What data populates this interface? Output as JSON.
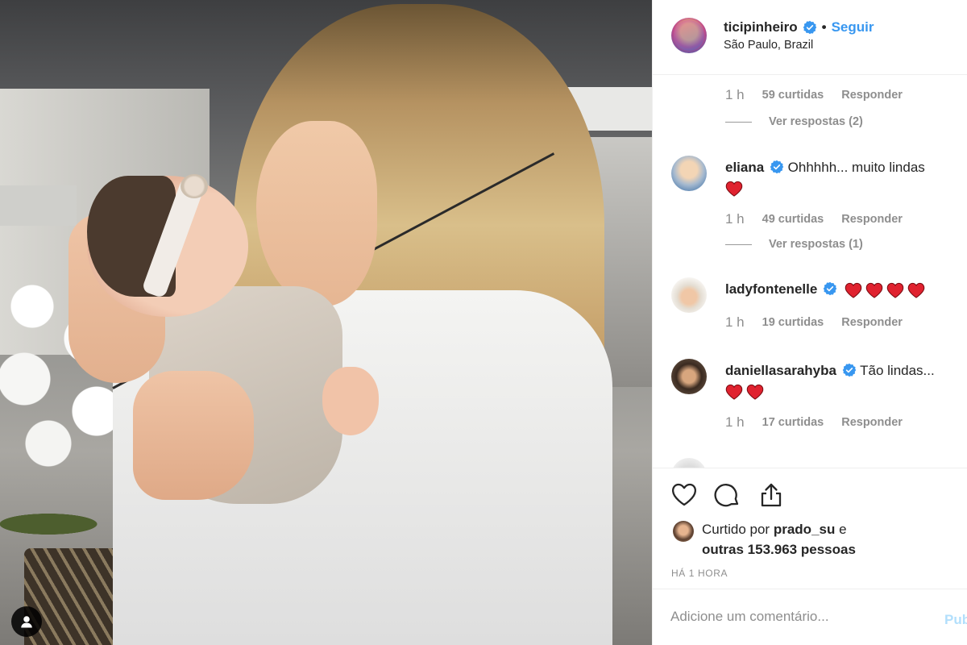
{
  "post": {
    "username": "ticipinheiro",
    "follow_label": "Seguir",
    "separator": "•",
    "location": "São Paulo, Brazil"
  },
  "comments": [
    {
      "time": "1 h",
      "likes": "59 curtidas",
      "reply": "Responder",
      "view_replies": "Ver respostas (2)"
    },
    {
      "username": "eliana",
      "text": "Ohhhhh... muito lindas",
      "hearts": 1,
      "time": "1 h",
      "likes": "49 curtidas",
      "reply": "Responder",
      "view_replies": "Ver respostas (1)"
    },
    {
      "username": "ladyfontenelle",
      "text": "",
      "hearts": 4,
      "time": "1 h",
      "likes": "19 curtidas",
      "reply": "Responder"
    },
    {
      "username": "daniellasarahyba",
      "text": "Tão lindas...",
      "hearts": 2,
      "time": "1 h",
      "likes": "17 curtidas",
      "reply": "Responder"
    }
  ],
  "likes": {
    "prefix": "Curtido por",
    "user": "prado_su",
    "conjunction": "e",
    "others": "outras 153.963 pessoas"
  },
  "time_ago": "HÁ 1 HORA",
  "add_comment": {
    "placeholder": "Adicione um comentário...",
    "publish_label": "Pub"
  },
  "icons": {
    "verified": "verified-badge-icon",
    "heart": "heart-emoji-icon",
    "like": "heart-outline-icon",
    "comment": "comment-bubble-icon",
    "share": "share-icon",
    "user": "user-silhouette-icon"
  },
  "colors": {
    "accent": "#3897f0",
    "muted": "#8e8e8e",
    "text": "#262626",
    "heart": "#e0222f",
    "publish_disabled": "#b2dffc"
  }
}
